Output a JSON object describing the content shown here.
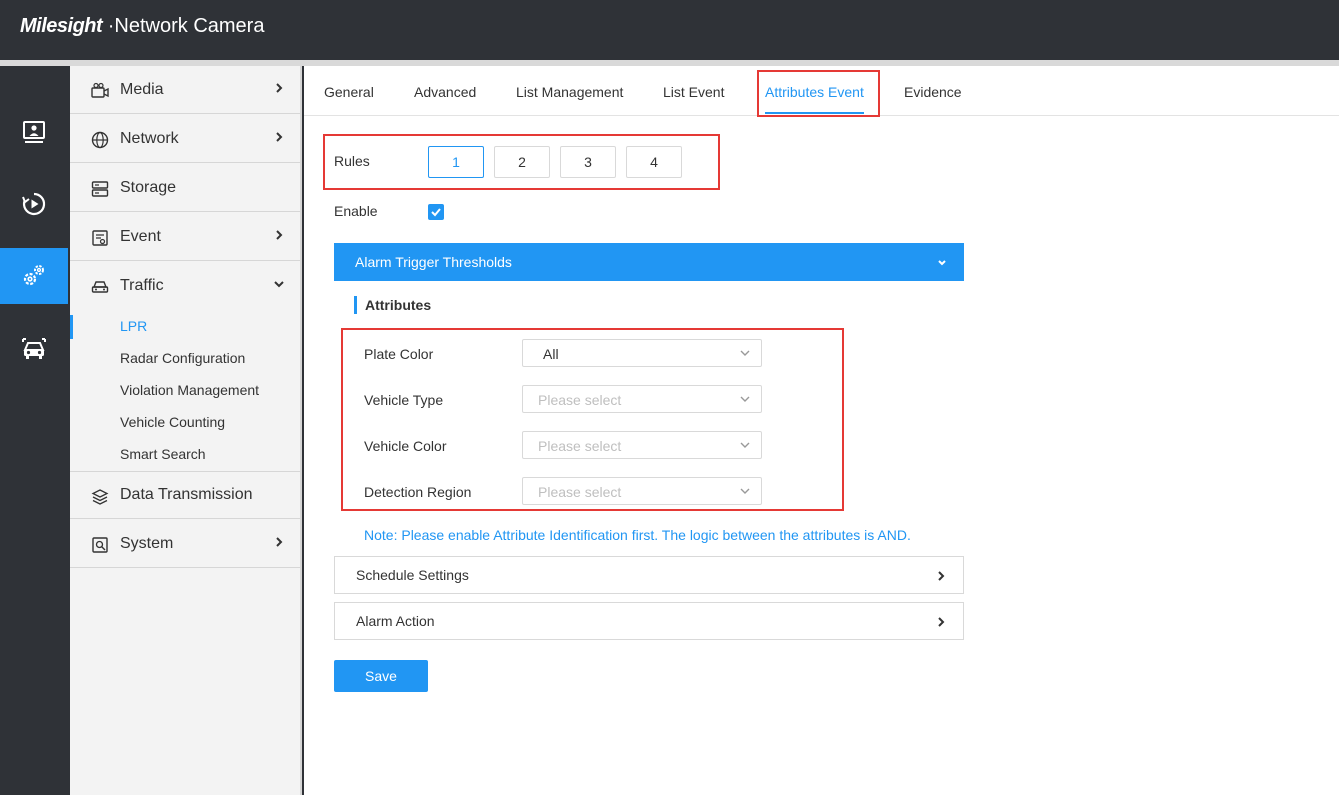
{
  "header": {
    "brand_logo": "Milesight",
    "brand_dot": "·",
    "brand_title": "Network Camera"
  },
  "icon_rail": [
    {
      "icon": "live-view-icon"
    },
    {
      "icon": "playback-icon"
    },
    {
      "icon": "settings-icon",
      "active": true
    },
    {
      "icon": "vehicle-icon"
    }
  ],
  "sidebar": {
    "media": "Media",
    "network": "Network",
    "storage": "Storage",
    "event": "Event",
    "traffic": "Traffic",
    "traffic_sub": {
      "lpr": "LPR",
      "radar": "Radar Configuration",
      "violation": "Violation Management",
      "counting": "Vehicle Counting",
      "smart_search": "Smart Search"
    },
    "data_transmission": "Data Transmission",
    "system": "System"
  },
  "tabs": {
    "general": "General",
    "advanced": "Advanced",
    "list_management": "List Management",
    "list_event": "List Event",
    "attributes_event": "Attributes Event",
    "evidence": "Evidence"
  },
  "form": {
    "rules_label": "Rules",
    "rules": [
      "1",
      "2",
      "3",
      "4"
    ],
    "active_rule": "1",
    "enable_label": "Enable",
    "enable_checked": true,
    "alarm_section": "Alarm Trigger Thresholds",
    "attributes_heading": "Attributes",
    "plate_color_label": "Plate Color",
    "plate_color_value": "All",
    "vehicle_type_label": "Vehicle Type",
    "vehicle_type_placeholder": "Please select",
    "vehicle_color_label": "Vehicle Color",
    "vehicle_color_placeholder": "Please select",
    "detection_region_label": "Detection Region",
    "detection_region_placeholder": "Please select",
    "note": "Note: Please enable Attribute Identification first. The logic between the attributes is AND.",
    "schedule_section": "Schedule Settings",
    "alarm_action_section": "Alarm Action",
    "save_label": "Save"
  },
  "colors": {
    "accent": "#2196f3",
    "highlight": "#e53935",
    "dark": "#2f3237"
  }
}
